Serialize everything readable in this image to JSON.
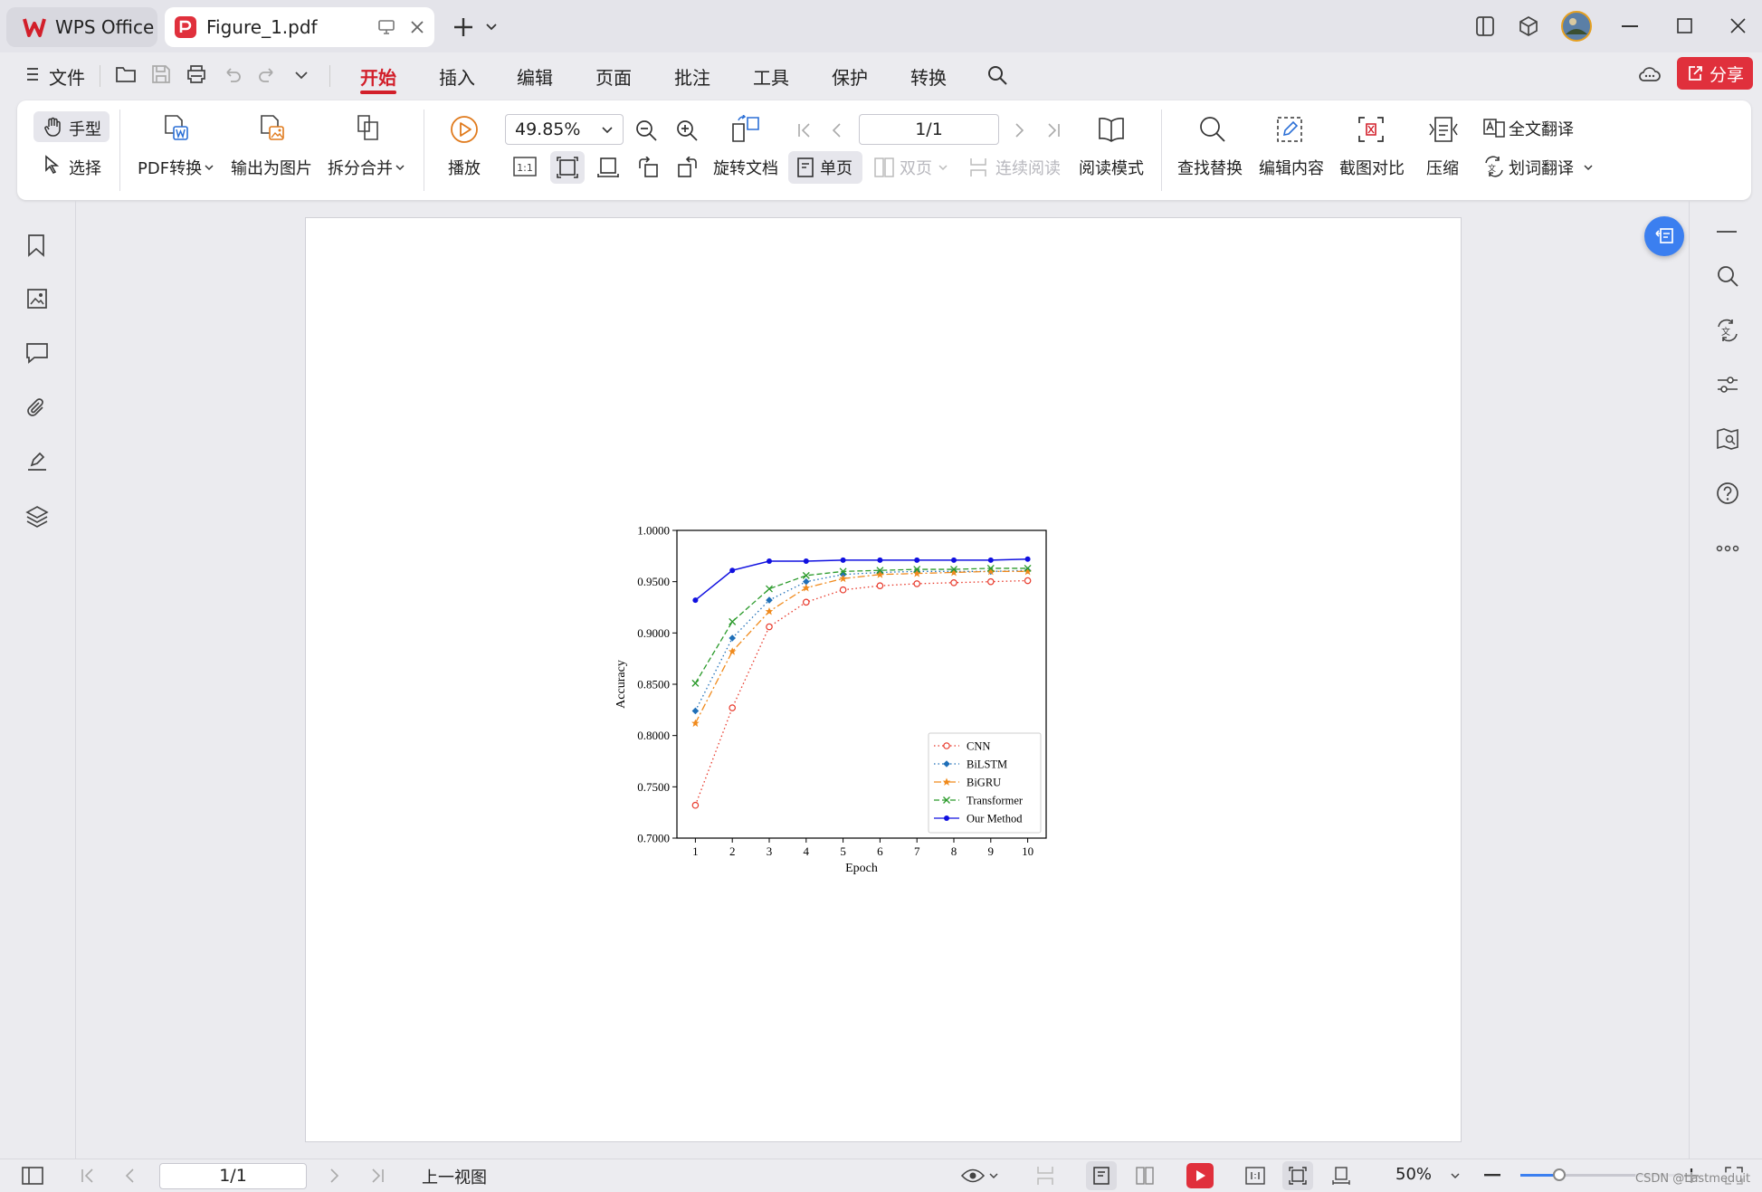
{
  "tabs": {
    "home_label": "WPS Office",
    "doc_label": "Figure_1.pdf"
  },
  "menu": {
    "file": "文件",
    "items": [
      "开始",
      "插入",
      "编辑",
      "页面",
      "批注",
      "工具",
      "保护",
      "转换"
    ],
    "active": "开始",
    "share": "分享"
  },
  "ribbon": {
    "hand": "手型",
    "select": "选择",
    "pdf_convert": "PDF转换",
    "export_image": "输出为图片",
    "split_merge": "拆分合并",
    "play": "播放",
    "zoom_value": "49.85%",
    "page_value": "1/1",
    "rotate": "旋转文档",
    "single_page": "单页",
    "double_page": "双页",
    "continuous": "连续阅读",
    "read_mode": "阅读模式",
    "find_replace": "查找替换",
    "edit_content": "编辑内容",
    "screenshot_compare": "截图对比",
    "compress": "压缩",
    "full_translate": "全文翻译",
    "word_translate": "划词翻译"
  },
  "statusbar": {
    "page_value": "1/1",
    "prev_view": "上一视图",
    "zoom": "50%",
    "watermark": "CSDN @Lastmeduit"
  },
  "colors": {
    "accent": "#d21f2a",
    "share_bg": "#e0303c",
    "cnn": "#e8382a",
    "bilstm": "#1f6fb8",
    "bigru": "#f08a1c",
    "transformer": "#2a9a2a",
    "ours": "#1010e0"
  },
  "chart_data": {
    "type": "line",
    "xlabel": "Epoch",
    "ylabel": "Accuracy",
    "x": [
      1,
      2,
      3,
      4,
      5,
      6,
      7,
      8,
      9,
      10
    ],
    "xticks": [
      "1",
      "2",
      "3",
      "4",
      "5",
      "6",
      "7",
      "8",
      "9",
      "10"
    ],
    "ylim": [
      0.7,
      1.0
    ],
    "yticks": [
      "0.7000",
      "0.7500",
      "0.8000",
      "0.8500",
      "0.9000",
      "0.9500",
      "1.0000"
    ],
    "legend_position": "lower-right",
    "grid": false,
    "series": [
      {
        "name": "CNN",
        "style": "dotted",
        "marker": "circle-open",
        "color": "#e8382a",
        "values": [
          0.732,
          0.827,
          0.906,
          0.93,
          0.942,
          0.946,
          0.948,
          0.949,
          0.95,
          0.951
        ]
      },
      {
        "name": "BiLSTM",
        "style": "dotted",
        "marker": "diamond",
        "color": "#1f6fb8",
        "values": [
          0.824,
          0.895,
          0.932,
          0.95,
          0.957,
          0.959,
          0.96,
          0.96,
          0.96,
          0.961
        ]
      },
      {
        "name": "BiGRU",
        "style": "dashdot",
        "marker": "star",
        "color": "#f08a1c",
        "values": [
          0.812,
          0.882,
          0.921,
          0.944,
          0.953,
          0.957,
          0.958,
          0.959,
          0.96,
          0.96
        ]
      },
      {
        "name": "Transformer",
        "style": "dashed",
        "marker": "x",
        "color": "#2a9a2a",
        "values": [
          0.851,
          0.911,
          0.943,
          0.956,
          0.96,
          0.961,
          0.962,
          0.962,
          0.963,
          0.963
        ]
      },
      {
        "name": "Our Method",
        "style": "solid",
        "marker": "dot",
        "color": "#1010e0",
        "values": [
          0.932,
          0.961,
          0.97,
          0.97,
          0.971,
          0.971,
          0.971,
          0.971,
          0.971,
          0.972
        ]
      }
    ]
  }
}
